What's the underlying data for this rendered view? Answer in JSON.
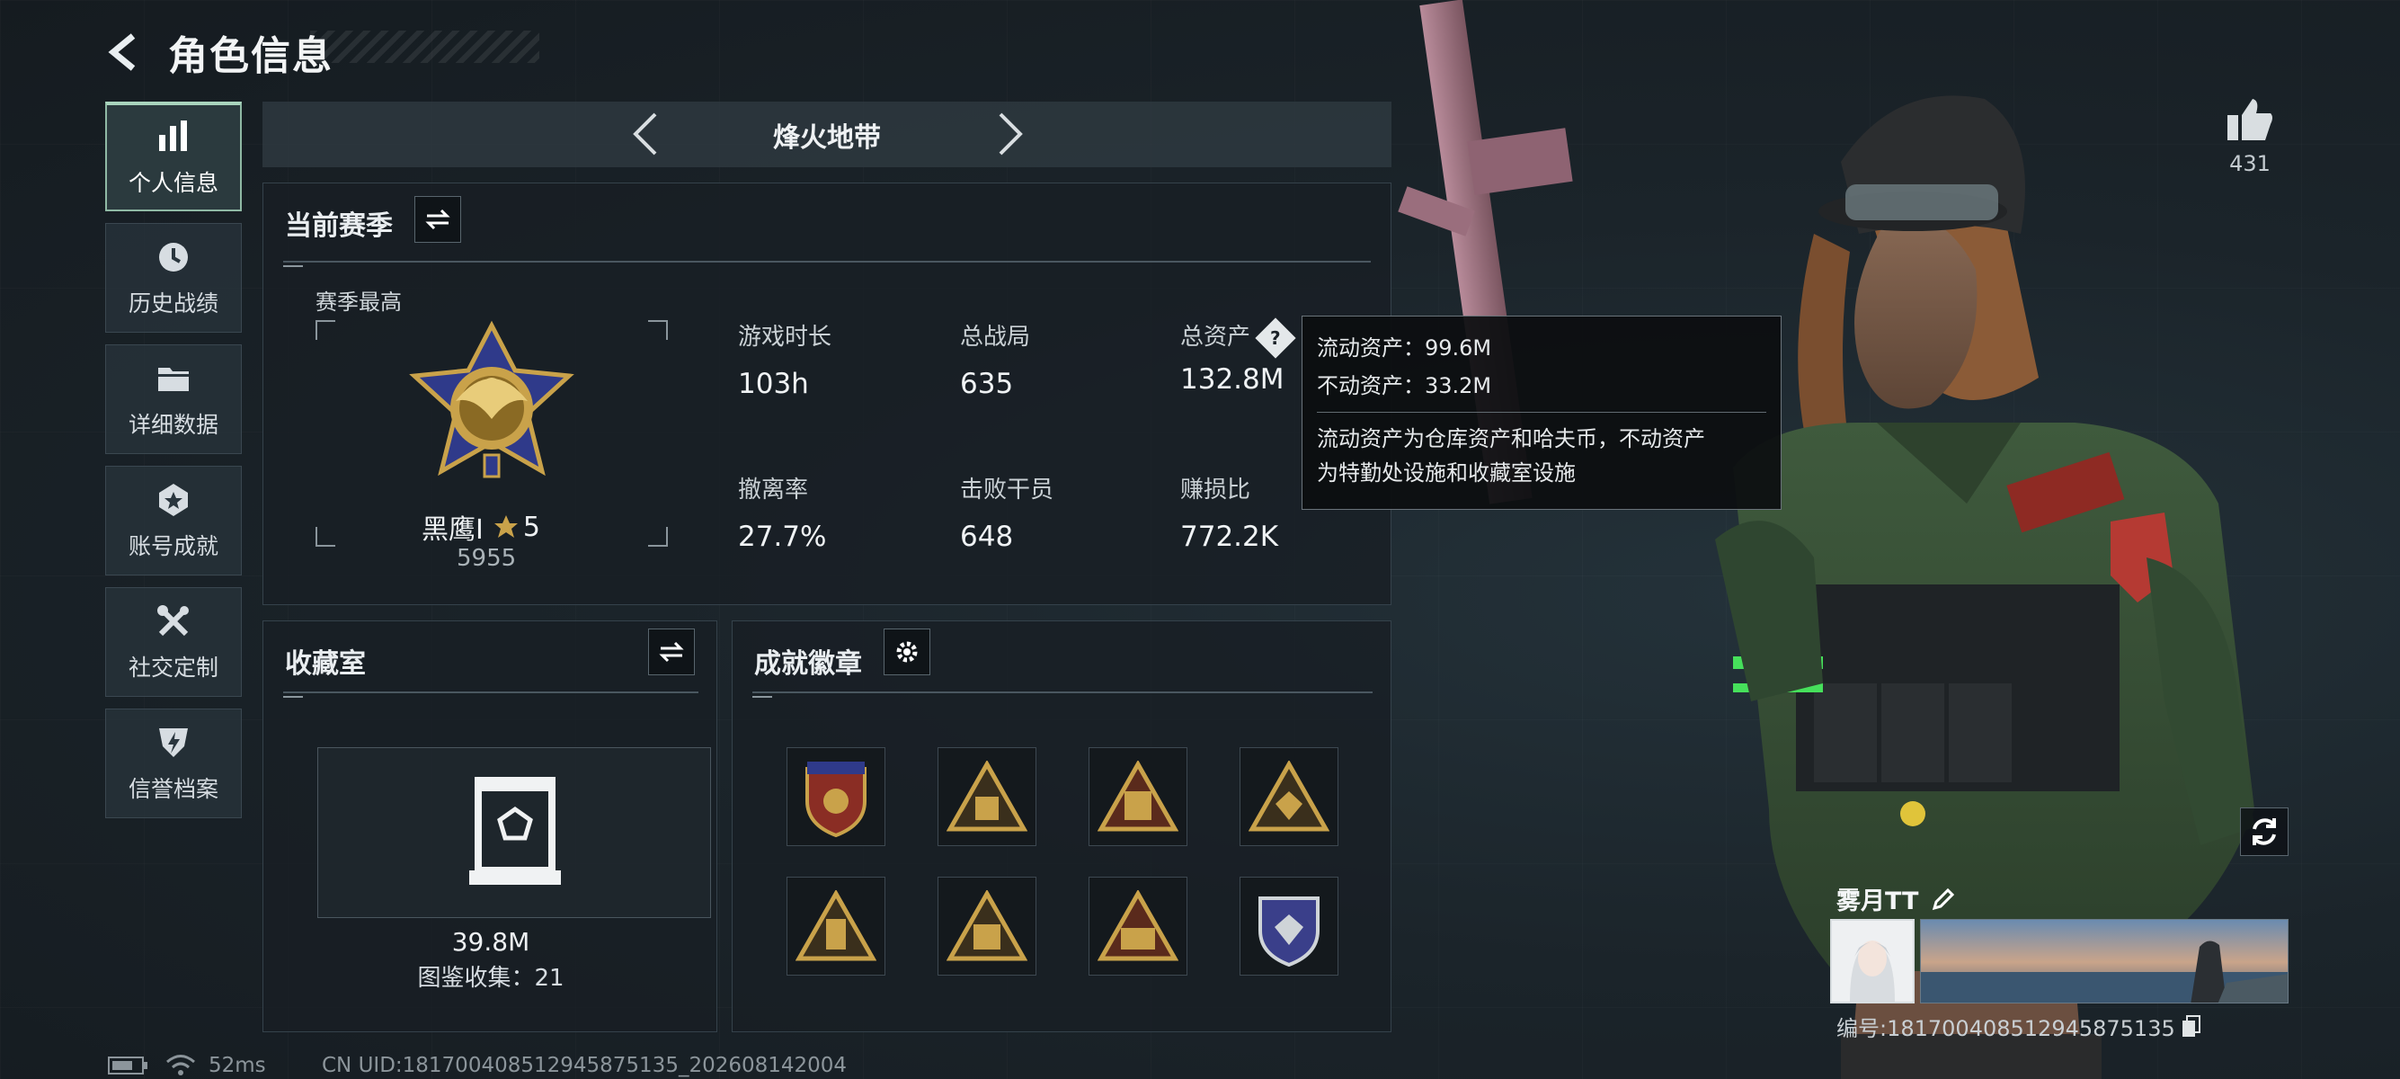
{
  "header": {
    "title": "角色信息"
  },
  "nav": [
    {
      "label": "个人信息",
      "icon": "bar-chart-icon",
      "active": true
    },
    {
      "label": "历史战绩",
      "icon": "history-clock-icon",
      "active": false
    },
    {
      "label": "详细数据",
      "icon": "folder-icon",
      "active": false
    },
    {
      "label": "账号成就",
      "icon": "achievement-badge-icon",
      "active": false
    },
    {
      "label": "社交定制",
      "icon": "wrench-tools-icon",
      "active": false
    },
    {
      "label": "信誉档案",
      "icon": "credit-shield-icon",
      "active": false
    }
  ],
  "mode": {
    "title": "烽火地带"
  },
  "season": {
    "title": "当前赛季",
    "best_label": "赛季最高",
    "rank_name": "黑鹰I",
    "rank_stars": "5",
    "rank_points": "5955",
    "stats": [
      {
        "label": "游戏时长",
        "value": "103h"
      },
      {
        "label": "总战局",
        "value": "635"
      },
      {
        "label": "总资产",
        "value": "132.8M"
      },
      {
        "label": "撤离率",
        "value": "27.7%"
      },
      {
        "label": "击败干员",
        "value": "648"
      },
      {
        "label": "赚损比",
        "value": "772.2K"
      }
    ]
  },
  "tooltip": {
    "liquid": "流动资产：99.6M",
    "fixed": "不动资产：33.2M",
    "description_line1": "流动资产为仓库资产和哈夫币，不动资产",
    "description_line2": "为特勤处设施和收藏室设施"
  },
  "collection": {
    "title": "收藏室",
    "value": "39.8M",
    "catalog": "图鉴收集：21"
  },
  "badges": {
    "title": "成就徽章",
    "items": [
      "shield-emblem-badge",
      "bag-triangle-badge",
      "building-triangle-badge",
      "gem-triangle-badge",
      "lantern-triangle-badge",
      "box-triangle-badge",
      "tower-triangle-badge",
      "silver-gem-shield-badge"
    ]
  },
  "like": {
    "count": "431"
  },
  "player": {
    "name": "雾月TT",
    "id_text": "编号:181700408512945875135"
  },
  "status": {
    "ping": "52ms",
    "uid": "CN UID:181700408512945875135_202608142004"
  },
  "colors": {
    "accent": "#a9d4bd",
    "gold": "#c9a24a",
    "panel": "#181f25"
  }
}
